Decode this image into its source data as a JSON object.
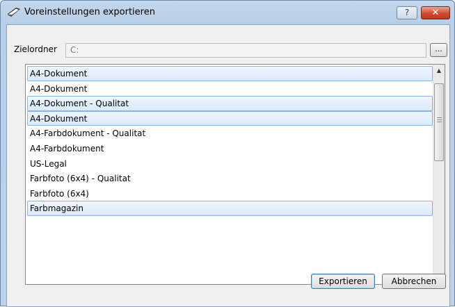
{
  "window": {
    "title": "Voreinstellungen exportieren",
    "help_label": "?",
    "close_label": "✕"
  },
  "folder": {
    "label": "Zielordner",
    "value": "C:",
    "browse_label": "..."
  },
  "list": {
    "items": [
      {
        "label": "A4-Dokument",
        "selected": true
      },
      {
        "label": "A4-Dokument",
        "selected": false
      },
      {
        "label": "A4-Dokument - Qualitat",
        "selected": true
      },
      {
        "label": "A4-Dokument",
        "selected": true
      },
      {
        "label": "A4-Farbdokument - Qualitat",
        "selected": false
      },
      {
        "label": "A4-Farbdokument",
        "selected": false
      },
      {
        "label": "US-Legal",
        "selected": false
      },
      {
        "label": "Farbfoto (6x4) - Qualitat",
        "selected": false
      },
      {
        "label": "Farbfoto (6x4)",
        "selected": false
      },
      {
        "label": "Farbmagazin",
        "selected": true
      }
    ]
  },
  "buttons": {
    "export_label": "Exportieren",
    "cancel_label": "Abbrechen"
  },
  "colors": {
    "selection_border": "#8bb3e6",
    "close_button": "#cf4a32"
  }
}
